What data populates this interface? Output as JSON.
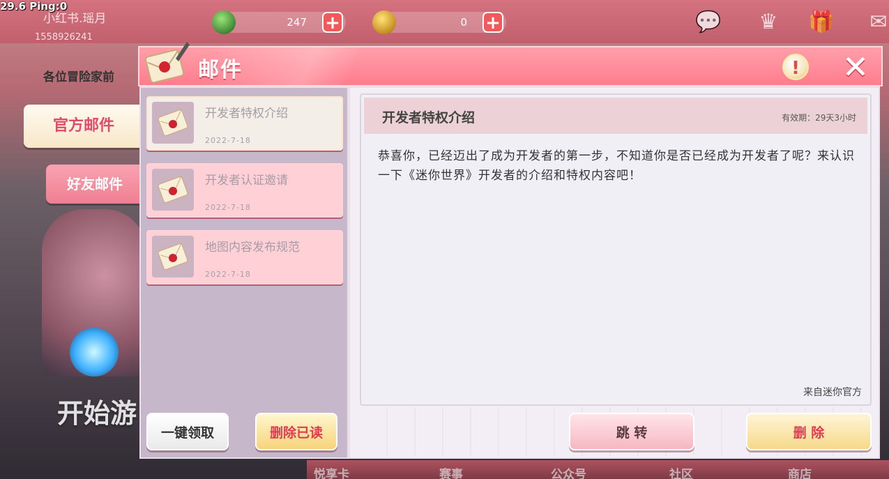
{
  "hud": {
    "fps_ping": "29.6  Ping:0",
    "player_name": "小红书.瑶月",
    "player_id": "1558926241",
    "gems": "247",
    "coins": "0"
  },
  "background": {
    "notice": "各位冒险家前",
    "start_button": "开始游",
    "bottom_menu": [
      "悦享卡",
      "赛事",
      "公众号",
      "社区",
      "商店"
    ]
  },
  "tabs": {
    "official": "官方邮件",
    "friend": "好友邮件"
  },
  "panel": {
    "title": "邮件",
    "info_symbol": "!",
    "close_symbol": "✕"
  },
  "mails": [
    {
      "subject": "开发者特权介绍",
      "date": "2022-7-18"
    },
    {
      "subject": "开发者认证邀请",
      "date": "2022-7-18"
    },
    {
      "subject": "地图内容发布规范",
      "date": "2022-7-18"
    }
  ],
  "buttons": {
    "claim_all": "一键领取",
    "delete_read": "删除已读",
    "jump": "跳 转",
    "delete": "删 除"
  },
  "detail": {
    "title": "开发者特权介绍",
    "validity": "有效期：29天3小时",
    "body": "恭喜你，已经迈出了成为开发者的第一步，不知道你是否已经成为开发者了呢？来认识一下《迷你世界》开发者的介绍和特权内容吧！",
    "sender": "来自迷你官方"
  },
  "colors": {
    "header": "#ff8595",
    "tab_active_text": "#e14a6b",
    "left_pane": "#c6b7cb",
    "delete_text": "#e23b51"
  }
}
